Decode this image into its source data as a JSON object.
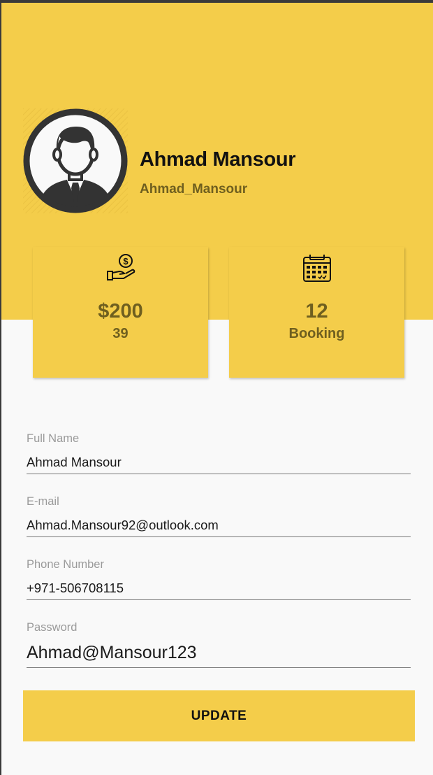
{
  "profile": {
    "name": "Ahmad Mansour",
    "username": "Ahmad_Mansour"
  },
  "stats": {
    "earnings": {
      "icon": "money-hand-icon",
      "value": "$200",
      "sub": "39"
    },
    "bookings": {
      "icon": "calendar-icon",
      "value": "12",
      "sub": "Booking"
    }
  },
  "form": {
    "full_name": {
      "label": "Full Name",
      "value": "Ahmad Mansour"
    },
    "email": {
      "label": "E-mail",
      "value": "Ahmad.Mansour92@outlook.com"
    },
    "phone": {
      "label": "Phone Number",
      "value": "+971-506708115"
    },
    "password": {
      "label": "Password",
      "value": "Ahmad@Mansour123"
    }
  },
  "update_label": "UPDATE",
  "colors": {
    "accent": "#f4cd4a",
    "muted_text": "#6f5f1f",
    "background": "#f9f9f9"
  }
}
